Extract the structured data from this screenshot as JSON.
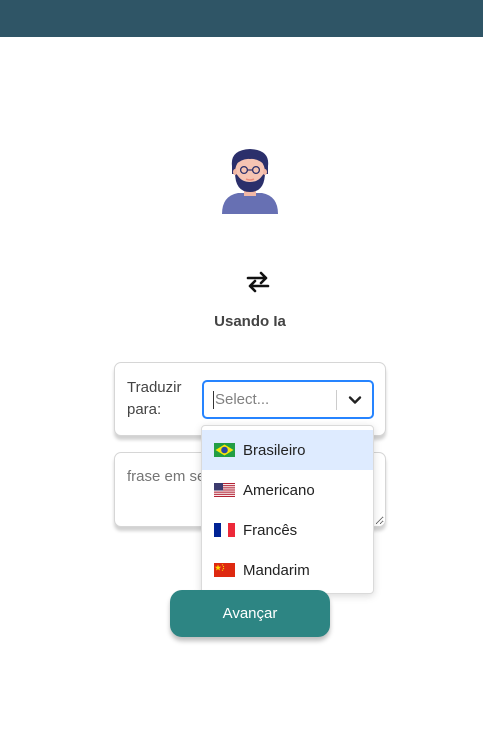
{
  "header": {
    "color": "#2f5566"
  },
  "avatar": {
    "icon": "bearded-man-avatar-icon"
  },
  "swap": {
    "icon": "swap-arrows-icon"
  },
  "subtitle": "Usando Ia",
  "language_selector": {
    "label": "Traduzir para:",
    "placeholder": "Select...",
    "focus_color": "#2684ff",
    "options": [
      {
        "label": "Brasileiro",
        "flag": "brazil-flag-icon",
        "highlighted": true
      },
      {
        "label": "Americano",
        "flag": "usa-flag-icon",
        "highlighted": false
      },
      {
        "label": "Francês",
        "flag": "france-flag-icon",
        "highlighted": false
      },
      {
        "label": "Mandarim",
        "flag": "china-flag-icon",
        "highlighted": false
      }
    ]
  },
  "phrase_input": {
    "placeholder": "frase em se"
  },
  "submit": {
    "label": "Avançar",
    "color": "#2d8583"
  }
}
